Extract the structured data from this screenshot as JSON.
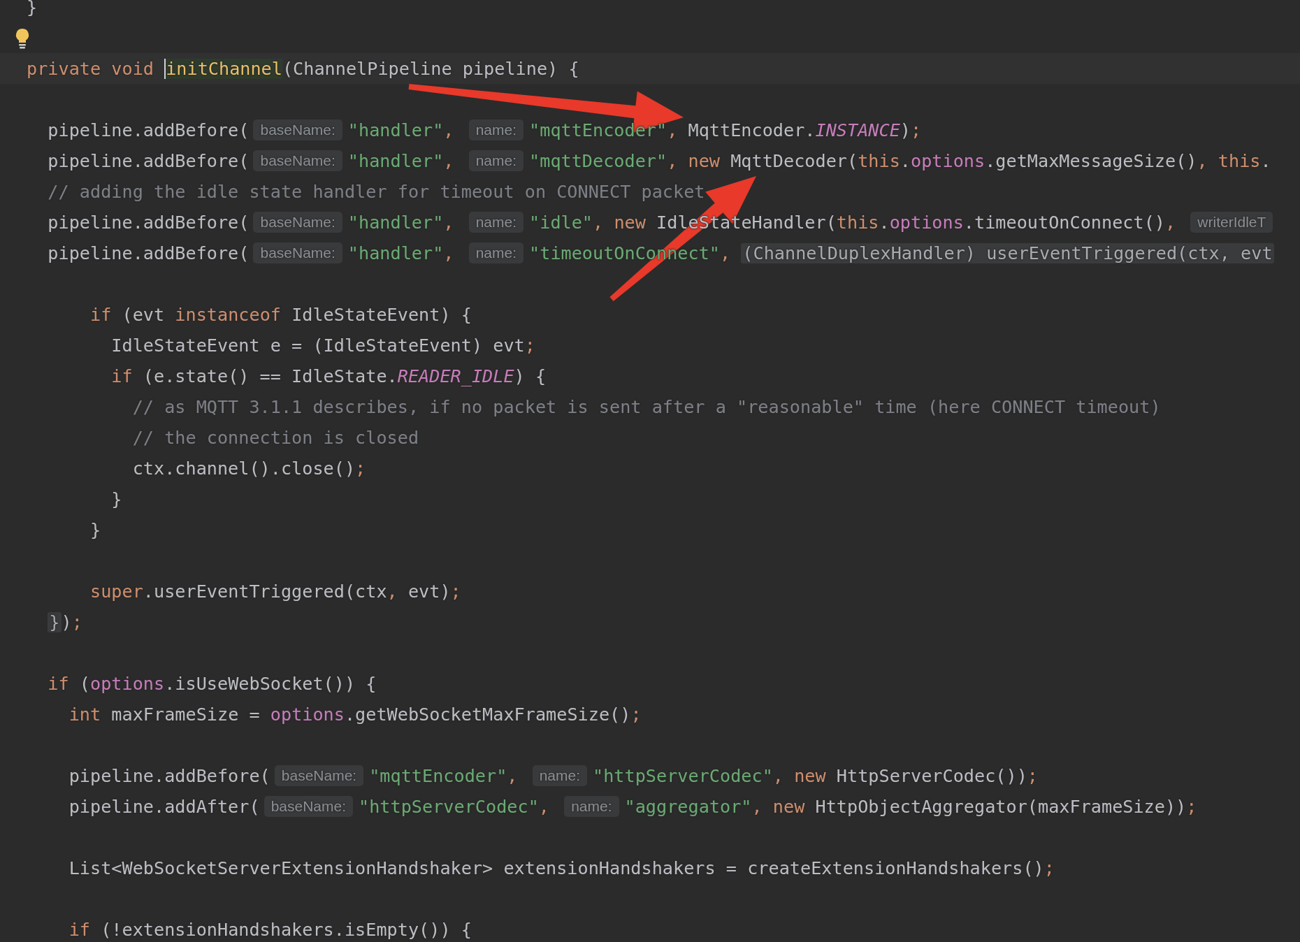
{
  "editor": {
    "lines": [
      {
        "kind": "code",
        "tokens": [
          {
            "kind": "plain",
            "text": "}"
          }
        ]
      },
      {
        "kind": "blank",
        "bulb": true
      },
      {
        "kind": "code",
        "current": true,
        "tokens": [
          {
            "kind": "keyword",
            "text": "private void "
          },
          {
            "kind": "method",
            "text": "initChannel",
            "caret": true
          },
          {
            "kind": "plain",
            "text": "(ChannelPipeline pipeline) {"
          }
        ]
      },
      {
        "kind": "blank"
      },
      {
        "kind": "code",
        "tokens": [
          {
            "kind": "plain",
            "text": "  pipeline.addBefore("
          },
          {
            "kind": "hint",
            "text": "baseName:"
          },
          {
            "kind": "string",
            "text": "\"handler\""
          },
          {
            "kind": "punct",
            "text": ", "
          },
          {
            "kind": "hint",
            "text": "name:"
          },
          {
            "kind": "string",
            "text": "\"mqttEncoder\""
          },
          {
            "kind": "punct",
            "text": ", "
          },
          {
            "kind": "plain",
            "text": "MqttEncoder."
          },
          {
            "kind": "constant",
            "text": "INSTANCE"
          },
          {
            "kind": "plain",
            "text": ")"
          },
          {
            "kind": "punct",
            "text": ";"
          }
        ]
      },
      {
        "kind": "code",
        "tokens": [
          {
            "kind": "plain",
            "text": "  pipeline.addBefore("
          },
          {
            "kind": "hint",
            "text": "baseName:"
          },
          {
            "kind": "string",
            "text": "\"handler\""
          },
          {
            "kind": "punct",
            "text": ", "
          },
          {
            "kind": "hint",
            "text": "name:"
          },
          {
            "kind": "string",
            "text": "\"mqttDecoder\""
          },
          {
            "kind": "punct",
            "text": ", "
          },
          {
            "kind": "keyword",
            "text": "new "
          },
          {
            "kind": "plain",
            "text": "MqttDecoder("
          },
          {
            "kind": "keyword",
            "text": "this"
          },
          {
            "kind": "plain",
            "text": "."
          },
          {
            "kind": "field",
            "text": "options"
          },
          {
            "kind": "plain",
            "text": ".getMaxMessageSize()"
          },
          {
            "kind": "punct",
            "text": ", "
          },
          {
            "kind": "keyword",
            "text": "this"
          },
          {
            "kind": "plain",
            "text": "."
          }
        ]
      },
      {
        "kind": "code",
        "tokens": [
          {
            "kind": "comment",
            "text": "  // adding the idle state handler for timeout on CONNECT packet"
          }
        ]
      },
      {
        "kind": "code",
        "tokens": [
          {
            "kind": "plain",
            "text": "  pipeline.addBefore("
          },
          {
            "kind": "hint",
            "text": "baseName:"
          },
          {
            "kind": "string",
            "text": "\"handler\""
          },
          {
            "kind": "punct",
            "text": ", "
          },
          {
            "kind": "hint",
            "text": "name:"
          },
          {
            "kind": "string",
            "text": "\"idle\""
          },
          {
            "kind": "punct",
            "text": ", "
          },
          {
            "kind": "keyword",
            "text": "new "
          },
          {
            "kind": "plain",
            "text": "IdleStateHandler("
          },
          {
            "kind": "keyword",
            "text": "this"
          },
          {
            "kind": "plain",
            "text": "."
          },
          {
            "kind": "field",
            "text": "options"
          },
          {
            "kind": "plain",
            "text": ".timeoutOnConnect()"
          },
          {
            "kind": "punct",
            "text": ", "
          },
          {
            "kind": "hint",
            "text": "writerIdleT"
          }
        ]
      },
      {
        "kind": "code",
        "tokens": [
          {
            "kind": "plain",
            "text": "  pipeline.addBefore("
          },
          {
            "kind": "hint",
            "text": "baseName:"
          },
          {
            "kind": "string",
            "text": "\"handler\""
          },
          {
            "kind": "punct",
            "text": ", "
          },
          {
            "kind": "hint",
            "text": "name:"
          },
          {
            "kind": "string",
            "text": "\"timeoutOnConnect\""
          },
          {
            "kind": "punct",
            "text": ", "
          },
          {
            "kind": "fold",
            "text": "(ChannelDuplexHandler) userEventTriggered(ctx, evt"
          }
        ]
      },
      {
        "kind": "blank"
      },
      {
        "kind": "code",
        "tokens": [
          {
            "kind": "keyword",
            "text": "      if "
          },
          {
            "kind": "plain",
            "text": "(evt "
          },
          {
            "kind": "keyword",
            "text": "instanceof "
          },
          {
            "kind": "plain",
            "text": "IdleStateEvent) {"
          }
        ]
      },
      {
        "kind": "code",
        "tokens": [
          {
            "kind": "plain",
            "text": "        IdleStateEvent e = (IdleStateEvent) evt"
          },
          {
            "kind": "punct",
            "text": ";"
          }
        ]
      },
      {
        "kind": "code",
        "tokens": [
          {
            "kind": "keyword",
            "text": "        if "
          },
          {
            "kind": "plain",
            "text": "(e.state() == IdleState."
          },
          {
            "kind": "constant",
            "text": "READER_IDLE"
          },
          {
            "kind": "plain",
            "text": ") {"
          }
        ]
      },
      {
        "kind": "code",
        "tokens": [
          {
            "kind": "comment",
            "text": "          // as MQTT 3.1.1 describes, if no packet is sent after a \"reasonable\" time (here CONNECT timeout)"
          }
        ]
      },
      {
        "kind": "code",
        "tokens": [
          {
            "kind": "comment",
            "text": "          // the connection is closed"
          }
        ]
      },
      {
        "kind": "code",
        "tokens": [
          {
            "kind": "plain",
            "text": "          ctx.channel().close()"
          },
          {
            "kind": "punct",
            "text": ";"
          }
        ]
      },
      {
        "kind": "code",
        "tokens": [
          {
            "kind": "plain",
            "text": "        }"
          }
        ]
      },
      {
        "kind": "code",
        "tokens": [
          {
            "kind": "plain",
            "text": "      }"
          }
        ]
      },
      {
        "kind": "blank"
      },
      {
        "kind": "code",
        "tokens": [
          {
            "kind": "keyword",
            "text": "      super"
          },
          {
            "kind": "plain",
            "text": ".userEventTriggered(ctx"
          },
          {
            "kind": "punct",
            "text": ", "
          },
          {
            "kind": "plain",
            "text": "evt)"
          },
          {
            "kind": "punct",
            "text": ";"
          }
        ]
      },
      {
        "kind": "code",
        "tokens": [
          {
            "kind": "fold",
            "text": "}"
          },
          {
            "kind": "plain",
            "text": ")"
          },
          {
            "kind": "punct",
            "text": ";"
          }
        ]
      },
      {
        "kind": "blank"
      },
      {
        "kind": "code",
        "tokens": [
          {
            "kind": "keyword",
            "text": "  if "
          },
          {
            "kind": "plain",
            "text": "("
          },
          {
            "kind": "field",
            "text": "options"
          },
          {
            "kind": "plain",
            "text": ".isUseWebSocket()) {"
          }
        ]
      },
      {
        "kind": "code",
        "tokens": [
          {
            "kind": "keyword",
            "text": "    int "
          },
          {
            "kind": "plain",
            "text": "maxFrameSize = "
          },
          {
            "kind": "field",
            "text": "options"
          },
          {
            "kind": "plain",
            "text": ".getWebSocketMaxFrameSize()"
          },
          {
            "kind": "punct",
            "text": ";"
          }
        ]
      },
      {
        "kind": "blank"
      },
      {
        "kind": "code",
        "tokens": [
          {
            "kind": "plain",
            "text": "    pipeline.addBefore("
          },
          {
            "kind": "hint",
            "text": "baseName:"
          },
          {
            "kind": "string",
            "text": "\"mqttEncoder\""
          },
          {
            "kind": "punct",
            "text": ", "
          },
          {
            "kind": "hint",
            "text": "name:"
          },
          {
            "kind": "string",
            "text": "\"httpServerCodec\""
          },
          {
            "kind": "punct",
            "text": ", "
          },
          {
            "kind": "keyword",
            "text": "new "
          },
          {
            "kind": "plain",
            "text": "HttpServerCodec())"
          },
          {
            "kind": "punct",
            "text": ";"
          }
        ]
      },
      {
        "kind": "code",
        "tokens": [
          {
            "kind": "plain",
            "text": "    pipeline.addAfter("
          },
          {
            "kind": "hint",
            "text": "baseName:"
          },
          {
            "kind": "string",
            "text": "\"httpServerCodec\""
          },
          {
            "kind": "punct",
            "text": ", "
          },
          {
            "kind": "hint",
            "text": "name:"
          },
          {
            "kind": "string",
            "text": "\"aggregator\""
          },
          {
            "kind": "punct",
            "text": ", "
          },
          {
            "kind": "keyword",
            "text": "new "
          },
          {
            "kind": "plain",
            "text": "HttpObjectAggregator(maxFrameSize))"
          },
          {
            "kind": "punct",
            "text": ";"
          }
        ]
      },
      {
        "kind": "blank"
      },
      {
        "kind": "code",
        "tokens": [
          {
            "kind": "plain",
            "text": "    List<WebSocketServerExtensionHandshaker> extensionHandshakers = createExtensionHandshakers()"
          },
          {
            "kind": "punct",
            "text": ";"
          }
        ]
      },
      {
        "kind": "blank"
      },
      {
        "kind": "code",
        "tokens": [
          {
            "kind": "keyword",
            "text": "    if "
          },
          {
            "kind": "plain",
            "text": "(!extensionHandshakers.isEmpty()) {"
          }
        ]
      }
    ]
  }
}
